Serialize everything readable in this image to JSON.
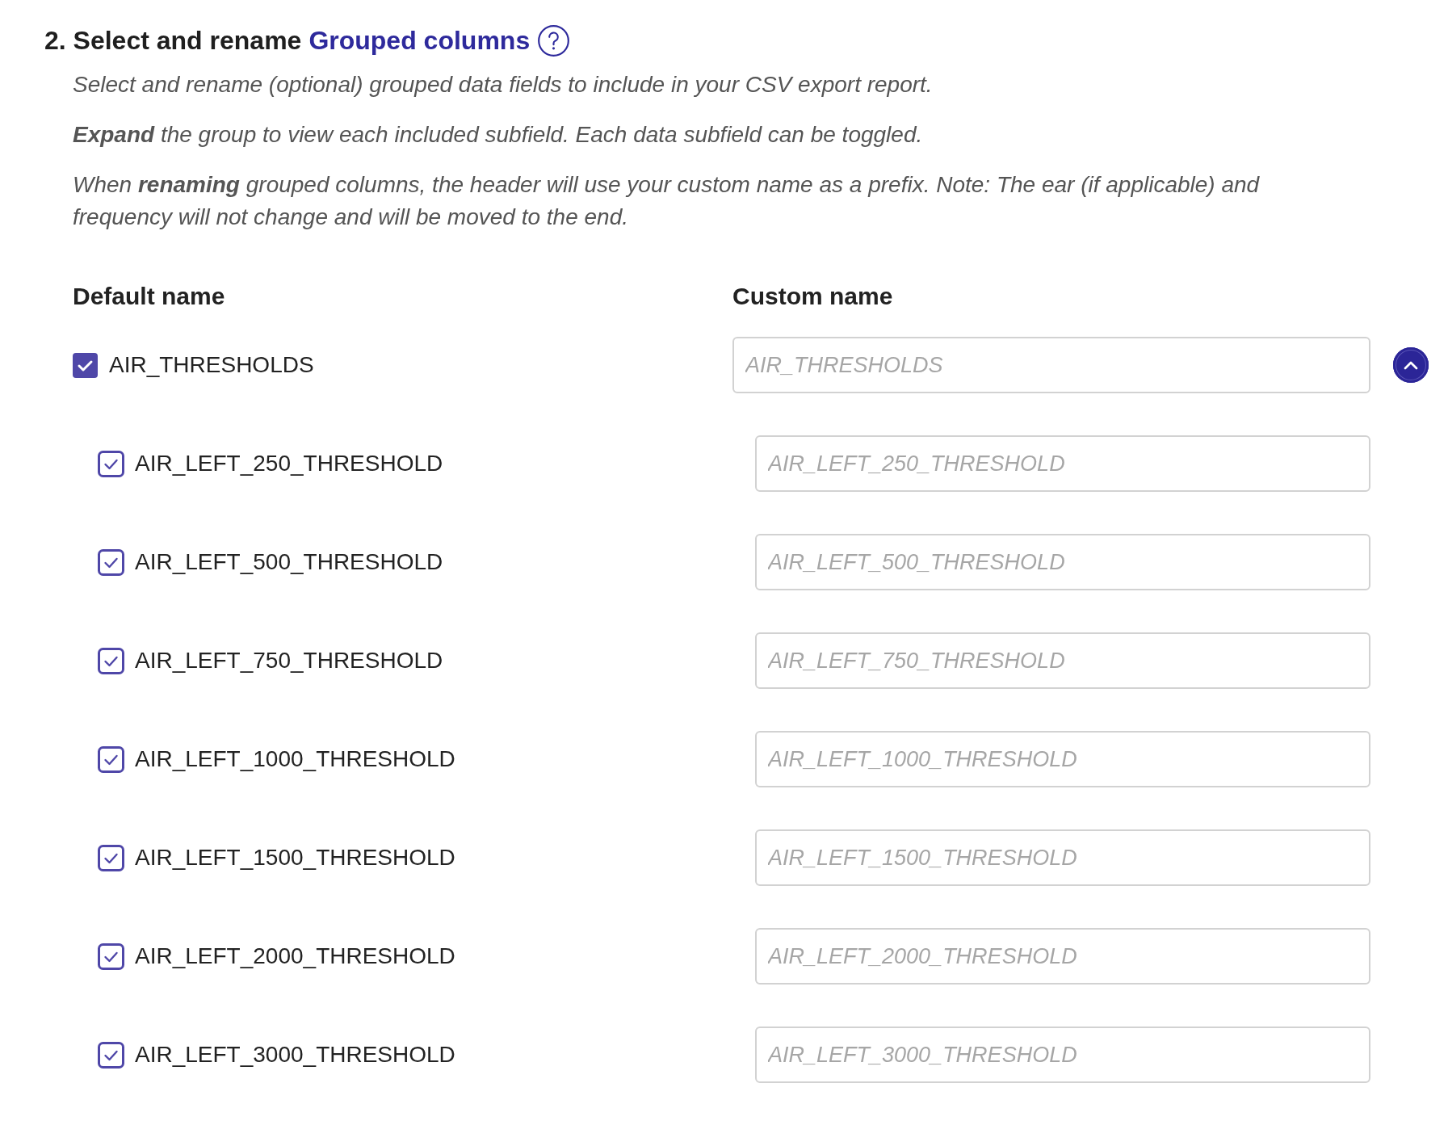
{
  "heading": {
    "text": "2. Select and rename",
    "link": "Grouped columns"
  },
  "descriptions": [
    "Select and rename (optional) grouped data fields to include in your CSV export report.",
    "**Expand** the group to view each included subfield. Each data subfield can be toggled.",
    "When **renaming** grouped columns, the header will use your custom name as a prefix. Note: The ear (if applicable) and frequency will not change and will be moved to the end."
  ],
  "columns": [
    "Default name",
    "Custom name"
  ],
  "group": {
    "label": "AIR_THRESHOLDS",
    "checked": true,
    "placeholder": "AIR_THRESHOLDS",
    "expanded": true,
    "children": [
      {
        "label": "AIR_LEFT_250_THRESHOLD",
        "checked": true,
        "placeholder": "AIR_LEFT_250_THRESHOLD"
      },
      {
        "label": "AIR_LEFT_500_THRESHOLD",
        "checked": true,
        "placeholder": "AIR_LEFT_500_THRESHOLD"
      },
      {
        "label": "AIR_LEFT_750_THRESHOLD",
        "checked": true,
        "placeholder": "AIR_LEFT_750_THRESHOLD"
      },
      {
        "label": "AIR_LEFT_1000_THRESHOLD",
        "checked": true,
        "placeholder": "AIR_LEFT_1000_THRESHOLD"
      },
      {
        "label": "AIR_LEFT_1500_THRESHOLD",
        "checked": true,
        "placeholder": "AIR_LEFT_1500_THRESHOLD"
      },
      {
        "label": "AIR_LEFT_2000_THRESHOLD",
        "checked": true,
        "placeholder": "AIR_LEFT_2000_THRESHOLD"
      },
      {
        "label": "AIR_LEFT_3000_THRESHOLD",
        "checked": true,
        "placeholder": "AIR_LEFT_3000_THRESHOLD"
      }
    ]
  }
}
